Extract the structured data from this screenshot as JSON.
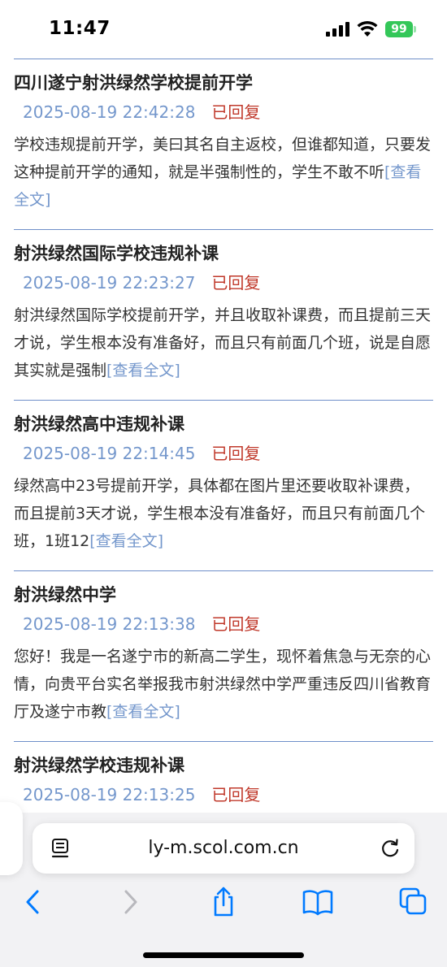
{
  "status_bar": {
    "time": "11:47",
    "battery": "99"
  },
  "items": [
    {
      "title": "四川遂宁射洪绿然学校提前开学",
      "date": "2025-08-19 22:42:28",
      "status": "已回复",
      "excerpt": "学校违规提前开学，美曰其名自主返校，但谁都知道，只要发这种提前开学的通知，就是半强制性的，学生不敢不听",
      "more": "[查看全文]"
    },
    {
      "title": "射洪绿然国际学校违规补课",
      "date": "2025-08-19 22:23:27",
      "status": "已回复",
      "excerpt": "射洪绿然国际学校提前开学，并且收取补课费，而且提前三天才说，学生根本没有准备好，而且只有前面几个班，说是自愿其实就是强制",
      "more": "[查看全文]"
    },
    {
      "title": "射洪绿然高中违规补课",
      "date": "2025-08-19 22:14:45",
      "status": "已回复",
      "excerpt": "绿然高中23号提前开学，具体都在图片里还要收取补课费，而且提前3天才说，学生根本没有准备好，而且只有前面几个班，1班12",
      "more": "[查看全文]"
    },
    {
      "title": "射洪绿然中学",
      "date": "2025-08-19 22:13:38",
      "status": "已回复",
      "excerpt": "您好！我是一名遂宁市的新高二学生，现怀着焦急与无奈的心情，向贵平台实名举报我市射洪绿然中学严重违反四川省教育厅及遂宁市教",
      "more": "[查看全文]"
    },
    {
      "title": "射洪绿然学校违规补课",
      "date": "2025-08-19 22:13:25",
      "status": "已回复",
      "excerpt": "",
      "more": ""
    }
  ],
  "browser": {
    "url": "ly-m.scol.com.cn"
  },
  "icons": {
    "signal": "cellular-signal-icon",
    "wifi": "wifi-icon",
    "battery": "battery-icon",
    "reader": "page-menu-icon",
    "reload": "reload-icon",
    "back": "back-chevron-icon",
    "forward": "forward-chevron-icon",
    "share": "share-icon",
    "bookmarks": "bookmarks-icon",
    "tabs": "tabs-icon"
  },
  "colors": {
    "link": "#7497cc",
    "status": "#c0392b",
    "divider": "#6f8fc9",
    "ios_blue": "#007aff",
    "battery": "#34c759"
  }
}
